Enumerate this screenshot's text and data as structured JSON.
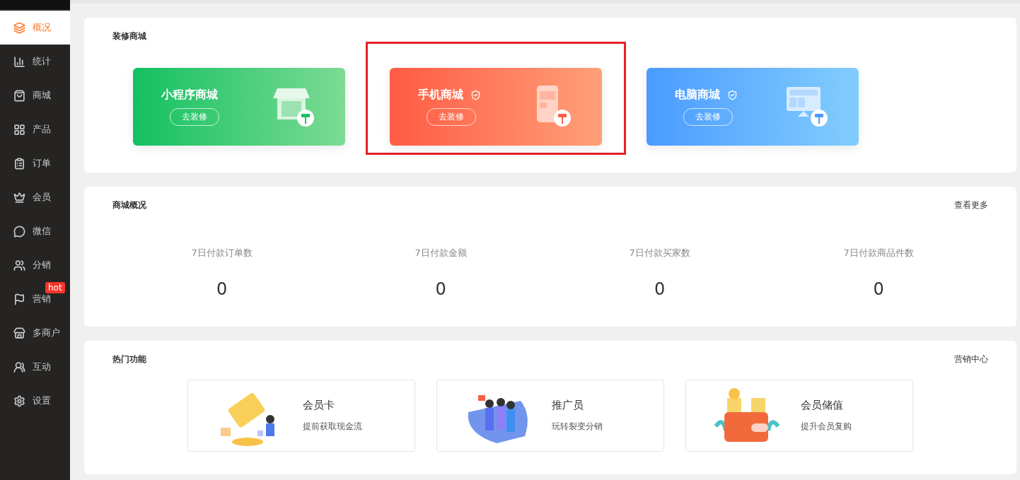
{
  "sidebar": {
    "items": [
      {
        "label": "概况",
        "selected": true
      },
      {
        "label": "统计",
        "selected": false
      },
      {
        "label": "商城",
        "selected": false
      },
      {
        "label": "产品",
        "selected": false
      },
      {
        "label": "订单",
        "selected": false
      },
      {
        "label": "会员",
        "selected": false
      },
      {
        "label": "微信",
        "selected": false
      },
      {
        "label": "分销",
        "selected": false
      },
      {
        "label": "营销",
        "selected": false,
        "badge": "hot"
      },
      {
        "label": "多商户",
        "selected": false
      },
      {
        "label": "互动",
        "selected": false
      },
      {
        "label": "设置",
        "selected": false
      }
    ]
  },
  "decorate": {
    "title": "装修商城",
    "cards": [
      {
        "kind": "miniprogram",
        "title": "小程序商城",
        "verified": false,
        "highlighted": false,
        "button": "去装修"
      },
      {
        "kind": "mobile",
        "title": "手机商城",
        "verified": true,
        "highlighted": true,
        "button": "去装修"
      },
      {
        "kind": "pc",
        "title": "电脑商城",
        "verified": true,
        "highlighted": false,
        "button": "去装修"
      }
    ]
  },
  "overview": {
    "title": "商城概况",
    "link": "查看更多",
    "stats": [
      {
        "label": "7日付款订单数",
        "value": "0"
      },
      {
        "label": "7日付款金额",
        "value": "0"
      },
      {
        "label": "7日付款买家数",
        "value": "0"
      },
      {
        "label": "7日付款商品件数",
        "value": "0"
      }
    ]
  },
  "features": {
    "title": "热门功能",
    "link": "营销中心",
    "items": [
      {
        "kind": "vip",
        "title": "会员卡",
        "subtitle": "提前获取现金流"
      },
      {
        "kind": "promoter",
        "title": "推广员",
        "subtitle": "玩转裂变分销"
      },
      {
        "kind": "wallet",
        "title": "会员储值",
        "subtitle": "提升会员复购"
      }
    ]
  }
}
